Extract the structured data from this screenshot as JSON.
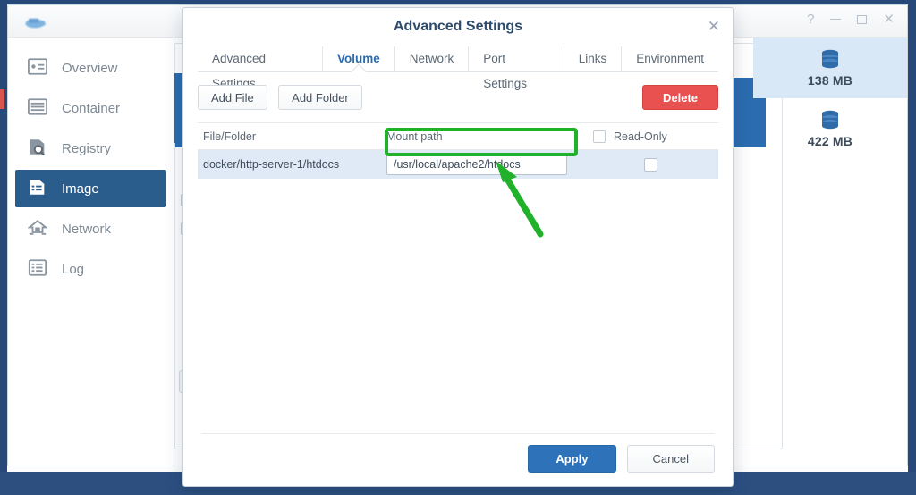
{
  "window": {
    "logo_icon": "docker-whale-icon",
    "controls": [
      {
        "name": "help-button",
        "glyph": "?"
      },
      {
        "name": "minimize-button",
        "glyph": "–"
      },
      {
        "name": "maximize-button",
        "glyph": "□"
      },
      {
        "name": "close-button",
        "glyph": "✕"
      }
    ]
  },
  "sidebar": {
    "items": [
      {
        "label": "Overview",
        "icon": "overview-icon",
        "active": false
      },
      {
        "label": "Container",
        "icon": "container-icon",
        "active": false
      },
      {
        "label": "Registry",
        "icon": "registry-icon",
        "active": false
      },
      {
        "label": "Image",
        "icon": "image-icon",
        "active": true
      },
      {
        "label": "Network",
        "icon": "network-icon",
        "active": false
      },
      {
        "label": "Log",
        "icon": "log-icon",
        "active": false
      }
    ]
  },
  "background": {
    "close_icon": "close-icon",
    "badges": [
      {
        "size": "138 MB",
        "icon": "database-icon",
        "selected": true
      },
      {
        "size": "422 MB",
        "icon": "database-icon",
        "selected": false
      }
    ]
  },
  "modal": {
    "title": "Advanced Settings",
    "close_icon": "close-icon",
    "tabs": [
      {
        "label": "Advanced Settings",
        "active": false
      },
      {
        "label": "Volume",
        "active": true
      },
      {
        "label": "Network",
        "active": false
      },
      {
        "label": "Port Settings",
        "active": false
      },
      {
        "label": "Links",
        "active": false
      },
      {
        "label": "Environment",
        "active": false
      }
    ],
    "toolbar": {
      "add_file": "Add File",
      "add_folder": "Add Folder",
      "delete": "Delete",
      "delete_color": "#e8514f"
    },
    "table": {
      "columns": {
        "file_folder": "File/Folder",
        "mount_path": "Mount path",
        "read_only": "Read-Only"
      },
      "header_read_only_checked": false,
      "rows": [
        {
          "file_folder": "docker/http-server-1/htdocs",
          "mount_path": "/usr/local/apache2/htdocs",
          "mount_path_placeholder": "Mount path",
          "read_only_checked": false
        }
      ]
    },
    "footer": {
      "apply": "Apply",
      "cancel": "Cancel",
      "apply_color": "#2e73ba"
    }
  },
  "annotation": {
    "color": "#21b12b",
    "highlight_target": "mount-path-input",
    "arrow_icon": "arrow-up-left-icon"
  }
}
